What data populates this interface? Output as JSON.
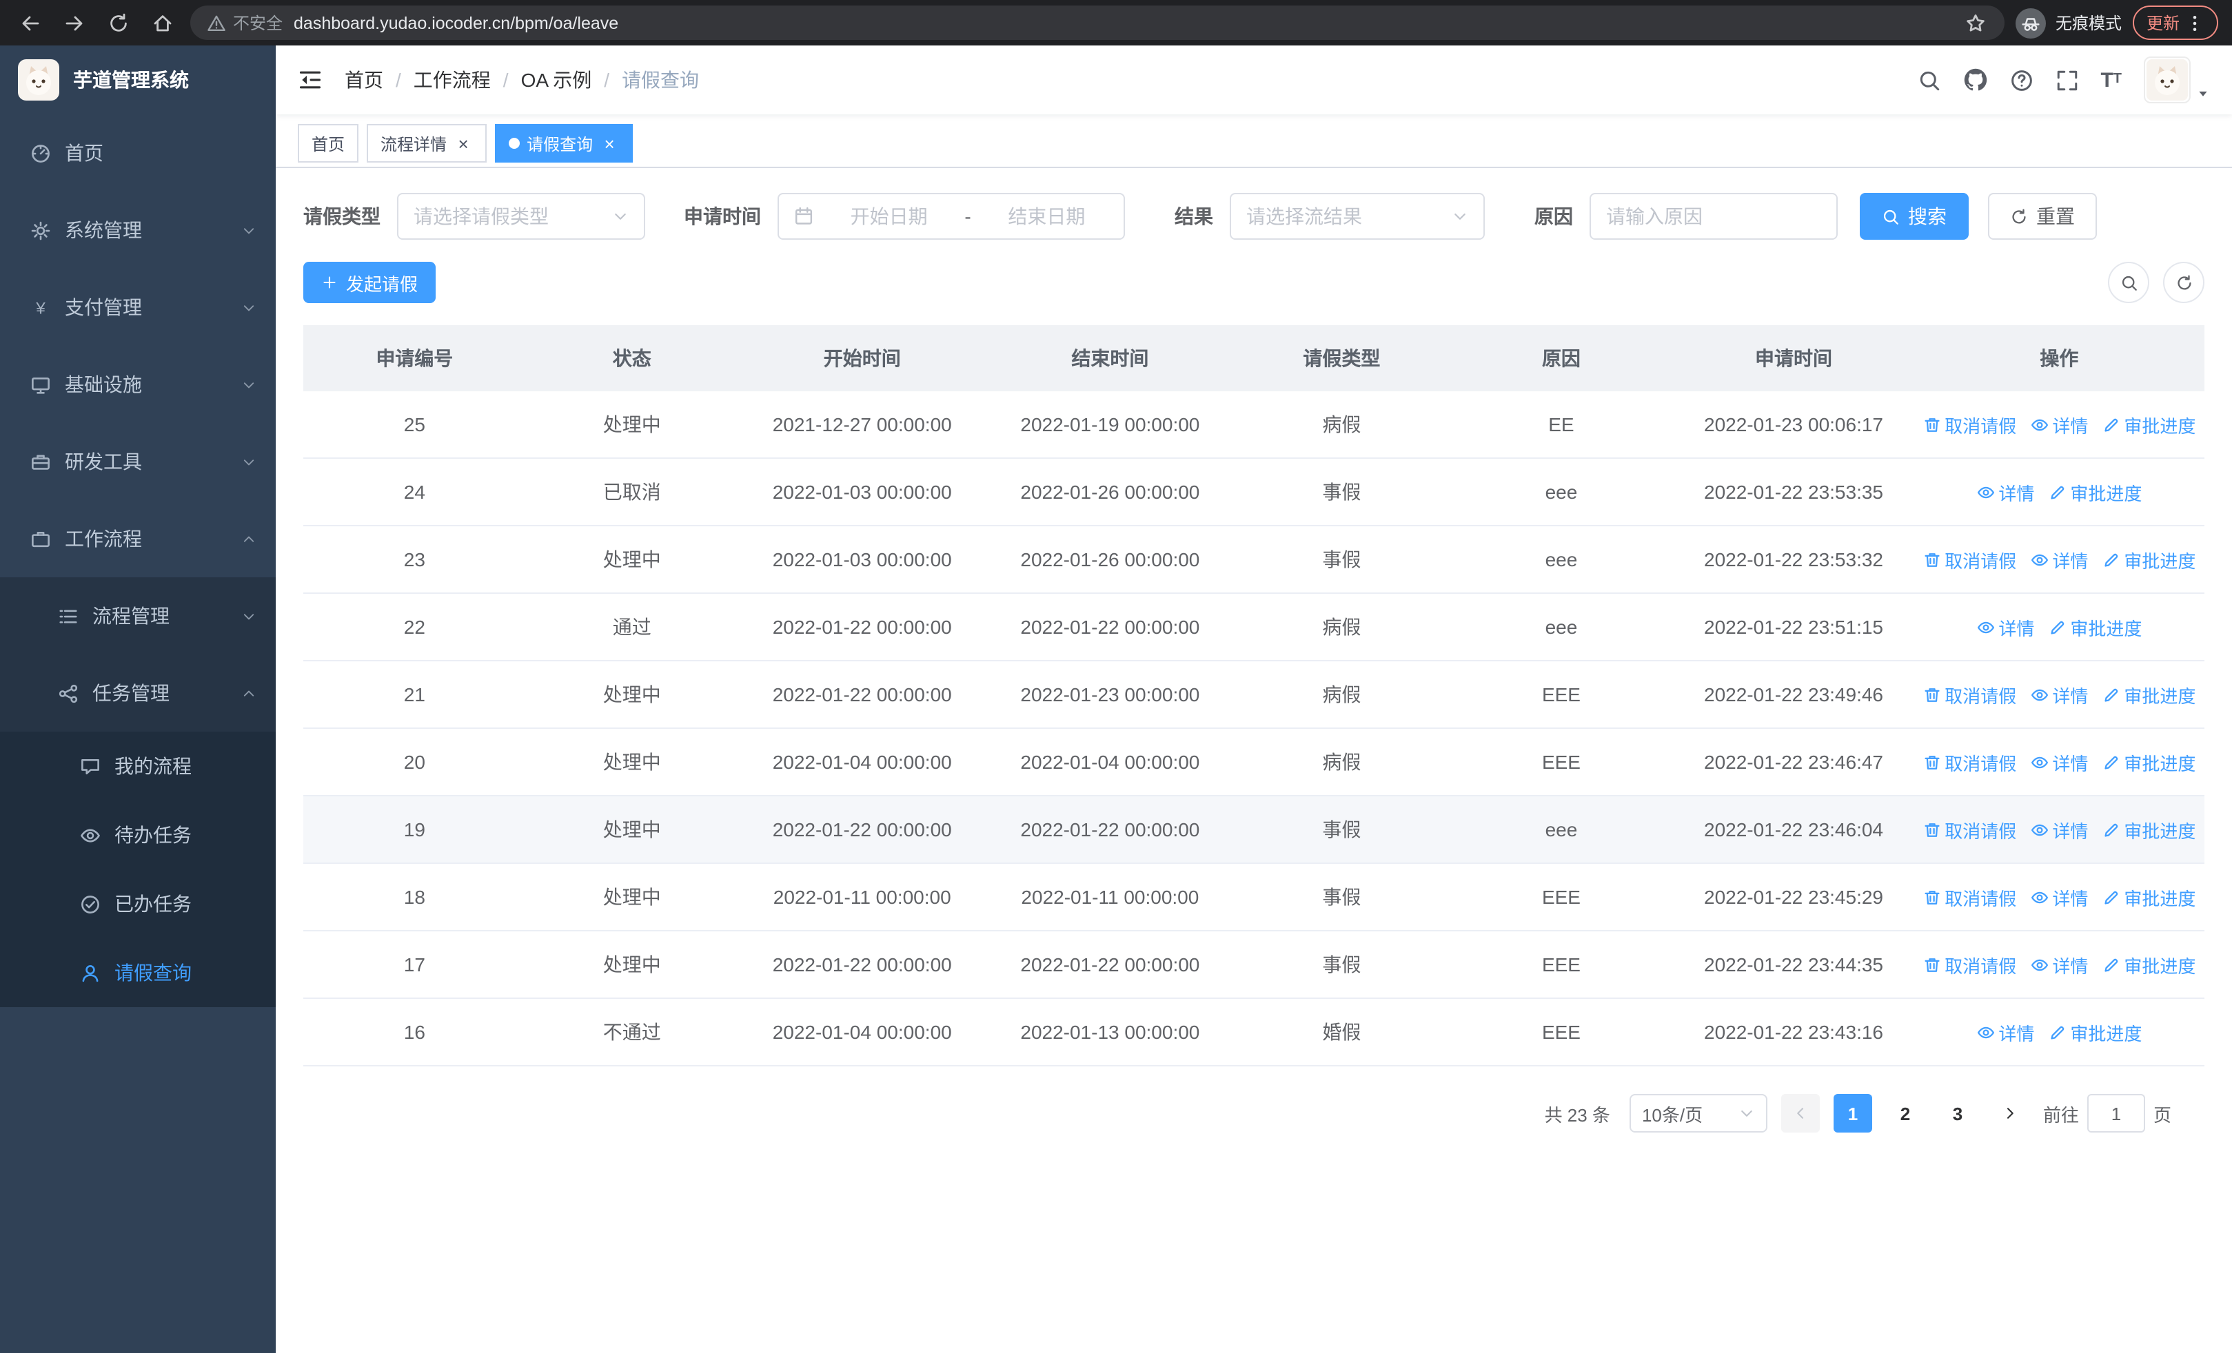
{
  "colors": {
    "accent": "#409eff",
    "sidebar_bg": "#304156",
    "sidebar_sub_bg": "#1f2d3d",
    "chrome_bg": "#202124"
  },
  "browser": {
    "security_label": "不安全",
    "url": "dashboard.yudao.iocoder.cn/bpm/oa/leave",
    "incognito_label": "无痕模式",
    "update_label": "更新"
  },
  "icons": {
    "back-icon": "left-arrow",
    "forward-icon": "right-arrow",
    "reload-icon": "circular-arrow",
    "home-icon": "house",
    "warning-icon": "triangle-!",
    "bookmark-star-icon": "star",
    "incognito-icon": "hat-glasses",
    "browser-menu-icon": "kebab-dots",
    "hamburger-icon": "fold-lines",
    "search-icon": "magnifier",
    "github-icon": "octocat",
    "help-icon": "question-circle",
    "fullscreen-icon": "expand-corners",
    "font-size-icon": "Tt",
    "avatar-caret-icon": "caret-down",
    "calendar-icon": "calendar",
    "refresh-icon": "circular-arrow",
    "plus-icon": "plus",
    "trash-icon": "trash",
    "eye-icon": "eye",
    "edit-icon": "pen",
    "chevron-down-icon": "v",
    "chevron-up-icon": "^"
  },
  "sidebar": {
    "logo_text": "芋道管理系统",
    "items": [
      {
        "key": "home",
        "label": "首页",
        "icon": "dashboard",
        "level": 1
      },
      {
        "key": "system",
        "label": "系统管理",
        "icon": "gear",
        "level": 1,
        "chevron": "down"
      },
      {
        "key": "payment",
        "label": "支付管理",
        "icon": "yen",
        "level": 1,
        "chevron": "down"
      },
      {
        "key": "infrastructure",
        "label": "基础设施",
        "icon": "monitor",
        "level": 1,
        "chevron": "down"
      },
      {
        "key": "devtools",
        "label": "研发工具",
        "icon": "toolbox",
        "level": 1,
        "chevron": "down"
      },
      {
        "key": "workflow",
        "label": "工作流程",
        "icon": "briefcase",
        "level": 1,
        "chevron": "up",
        "expanded": true
      },
      {
        "key": "process-management",
        "label": "流程管理",
        "icon": "list",
        "level": 2,
        "chevron": "down"
      },
      {
        "key": "task-management",
        "label": "任务管理",
        "icon": "share",
        "level": 2,
        "chevron": "up",
        "expanded": true
      },
      {
        "key": "my-process",
        "label": "我的流程",
        "icon": "chat",
        "level": 3
      },
      {
        "key": "todo-task",
        "label": "待办任务",
        "icon": "eye",
        "level": 3
      },
      {
        "key": "done-task",
        "label": "已办任务",
        "icon": "check",
        "level": 3
      },
      {
        "key": "leave-query",
        "label": "请假查询",
        "icon": "user",
        "level": 3,
        "active": true
      }
    ]
  },
  "navbar": {
    "breadcrumb": [
      "首页",
      "工作流程",
      "OA 示例",
      "请假查询"
    ]
  },
  "tabs": [
    {
      "label": "首页",
      "closable": false,
      "active": false
    },
    {
      "label": "流程详情",
      "closable": true,
      "active": false
    },
    {
      "label": "请假查询",
      "closable": true,
      "active": true
    }
  ],
  "filters": {
    "leave_type_label": "请假类型",
    "leave_type_placeholder": "请选择请假类型",
    "apply_time_label": "申请时间",
    "start_placeholder": "开始日期",
    "range_separator": "-",
    "end_placeholder": "结束日期",
    "result_label": "结果",
    "result_placeholder": "请选择流结果",
    "reason_label": "原因",
    "reason_placeholder": "请输入原因",
    "search_label": "搜索",
    "reset_label": "重置"
  },
  "toolbar": {
    "create_label": "发起请假"
  },
  "table": {
    "headers": [
      "申请编号",
      "状态",
      "开始时间",
      "结束时间",
      "请假类型",
      "原因",
      "申请时间",
      "操作"
    ],
    "action_labels": {
      "cancel": "取消请假",
      "detail": "详情",
      "progress": "审批进度"
    },
    "rows": [
      {
        "id": "25",
        "status": "处理中",
        "start": "2021-12-27 00:00:00",
        "end": "2022-01-19 00:00:00",
        "type": "病假",
        "reason": "EE",
        "applied": "2022-01-23 00:06:17",
        "actions": [
          "cancel",
          "detail",
          "progress"
        ],
        "highlight": false
      },
      {
        "id": "24",
        "status": "已取消",
        "start": "2022-01-03 00:00:00",
        "end": "2022-01-26 00:00:00",
        "type": "事假",
        "reason": "eee",
        "applied": "2022-01-22 23:53:35",
        "actions": [
          "detail",
          "progress"
        ],
        "highlight": false
      },
      {
        "id": "23",
        "status": "处理中",
        "start": "2022-01-03 00:00:00",
        "end": "2022-01-26 00:00:00",
        "type": "事假",
        "reason": "eee",
        "applied": "2022-01-22 23:53:32",
        "actions": [
          "cancel",
          "detail",
          "progress"
        ],
        "highlight": false
      },
      {
        "id": "22",
        "status": "通过",
        "start": "2022-01-22 00:00:00",
        "end": "2022-01-22 00:00:00",
        "type": "病假",
        "reason": "eee",
        "applied": "2022-01-22 23:51:15",
        "actions": [
          "detail",
          "progress"
        ],
        "highlight": false
      },
      {
        "id": "21",
        "status": "处理中",
        "start": "2022-01-22 00:00:00",
        "end": "2022-01-23 00:00:00",
        "type": "病假",
        "reason": "EEE",
        "applied": "2022-01-22 23:49:46",
        "actions": [
          "cancel",
          "detail",
          "progress"
        ],
        "highlight": false
      },
      {
        "id": "20",
        "status": "处理中",
        "start": "2022-01-04 00:00:00",
        "end": "2022-01-04 00:00:00",
        "type": "病假",
        "reason": "EEE",
        "applied": "2022-01-22 23:46:47",
        "actions": [
          "cancel",
          "detail",
          "progress"
        ],
        "highlight": false
      },
      {
        "id": "19",
        "status": "处理中",
        "start": "2022-01-22 00:00:00",
        "end": "2022-01-22 00:00:00",
        "type": "事假",
        "reason": "eee",
        "applied": "2022-01-22 23:46:04",
        "actions": [
          "cancel",
          "detail",
          "progress"
        ],
        "highlight": true
      },
      {
        "id": "18",
        "status": "处理中",
        "start": "2022-01-11 00:00:00",
        "end": "2022-01-11 00:00:00",
        "type": "事假",
        "reason": "EEE",
        "applied": "2022-01-22 23:45:29",
        "actions": [
          "cancel",
          "detail",
          "progress"
        ],
        "highlight": false
      },
      {
        "id": "17",
        "status": "处理中",
        "start": "2022-01-22 00:00:00",
        "end": "2022-01-22 00:00:00",
        "type": "事假",
        "reason": "EEE",
        "applied": "2022-01-22 23:44:35",
        "actions": [
          "cancel",
          "detail",
          "progress"
        ],
        "highlight": false
      },
      {
        "id": "16",
        "status": "不通过",
        "start": "2022-01-04 00:00:00",
        "end": "2022-01-13 00:00:00",
        "type": "婚假",
        "reason": "EEE",
        "applied": "2022-01-22 23:43:16",
        "actions": [
          "detail",
          "progress"
        ],
        "highlight": false
      }
    ]
  },
  "pagination": {
    "total_label": "共 23 条",
    "page_size_label": "10条/页",
    "pages": [
      "1",
      "2",
      "3"
    ],
    "current_page": "1",
    "goto_label": "前往",
    "goto_value": "1",
    "page_unit": "页"
  }
}
